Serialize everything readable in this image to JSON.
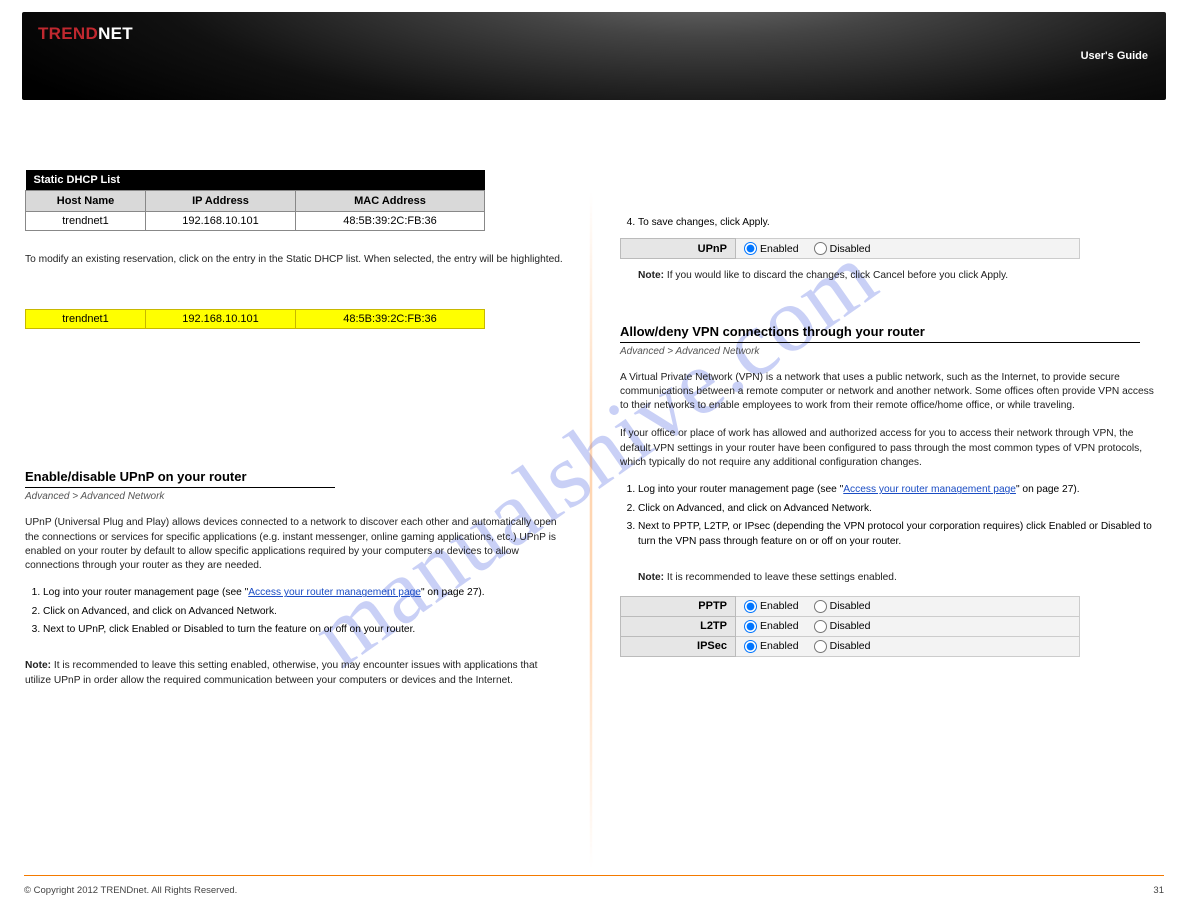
{
  "header": {
    "brand_prefix": "TREND",
    "brand_suffix": "NET",
    "guide_title": "User's Guide"
  },
  "static_dhcp": {
    "section_title": "Static DHCP List",
    "columns": [
      "Host Name",
      "IP Address",
      "MAC Address"
    ],
    "row": {
      "host": "trendnet1",
      "ip": "192.168.10.101",
      "mac": "48:5B:39:2C:FB:36"
    }
  },
  "left": {
    "para_after_table": "To modify an existing reservation, click on the entry in the Static DHCP list. When selected, the entry will be highlighted.",
    "hl_row": {
      "host": "trendnet1",
      "ip": "192.168.10.101",
      "mac": "48:5B:39:2C:FB:36"
    },
    "sec_heading": "Enable/disable UPnP on your router",
    "crumb": "Advanced > Advanced Network",
    "upnp_para1": "UPnP (Universal Plug and Play) allows devices connected to a network to discover each other and automatically open the connections or services for specific applications (e.g. instant messenger, online gaming applications, etc.) UPnP is enabled on your router by default to allow specific applications required by your computers or devices to allow connections through your router as they are needed.",
    "step1": "Log into your router management page (see \"",
    "step1_link": "Access your router management page",
    "step1_page_ref": "\" on page 27).",
    "step2": "Click on Advanced, and click on Advanced Network.",
    "step3": "Next to UPnP, click Enabled or Disabled to turn the feature on or off on your router.",
    "note_label": "Note:",
    "note_text": " It is recommended to leave this setting enabled, otherwise, you may encounter issues with applications that utilize UPnP in order allow the required communication between your computers or devices and the Internet."
  },
  "upnp_setting": {
    "label": "UPnP",
    "enabled": "Enabled",
    "disabled": "Disabled"
  },
  "right": {
    "step4": "To save changes, click Apply.",
    "step4_note_label": "Note:",
    "step4_note_text": " If you would like to discard the changes, click Cancel before you click Apply.",
    "sec_heading": "Allow/deny VPN connections through your router",
    "crumb": "Advanced > Advanced Network",
    "vpn_para1": "A Virtual Private Network (VPN) is a network that uses a public network, such as the Internet, to provide secure communications between a remote computer or network and another network. Some offices often provide VPN access to their networks to enable employees to work from their remote office/home office, or while traveling.",
    "vpn_para2": "If your office or place of work has allowed and authorized access for you to access their network through VPN, the default VPN settings in your router have been configured to pass through the most common types of VPN protocols, which typically do not require any additional configuration changes.",
    "step1": "Log into your router management page (see \"",
    "step1_link": "Access your router management page",
    "step1_page_ref": "\" on page 27).",
    "step2": "Click on Advanced, and click on Advanced Network.",
    "step3": "Next to PPTP, L2TP, or IPsec (depending the VPN protocol your corporation requires) click Enabled or Disabled to turn the VPN pass through feature on or off on your router.",
    "step3_note_label": "Note:",
    "step3_note_text": " It is recommended to leave these settings enabled."
  },
  "vpn_settings": {
    "rows": [
      {
        "label": "PPTP",
        "enabled": "Enabled",
        "disabled": "Disabled"
      },
      {
        "label": "L2TP",
        "enabled": "Enabled",
        "disabled": "Disabled"
      },
      {
        "label": "IPSec",
        "enabled": "Enabled",
        "disabled": "Disabled"
      }
    ]
  },
  "footer": {
    "copyright": "© Copyright 2012 TRENDnet. All Rights Reserved.",
    "page_number": "31"
  },
  "watermark": "manualshive.com"
}
